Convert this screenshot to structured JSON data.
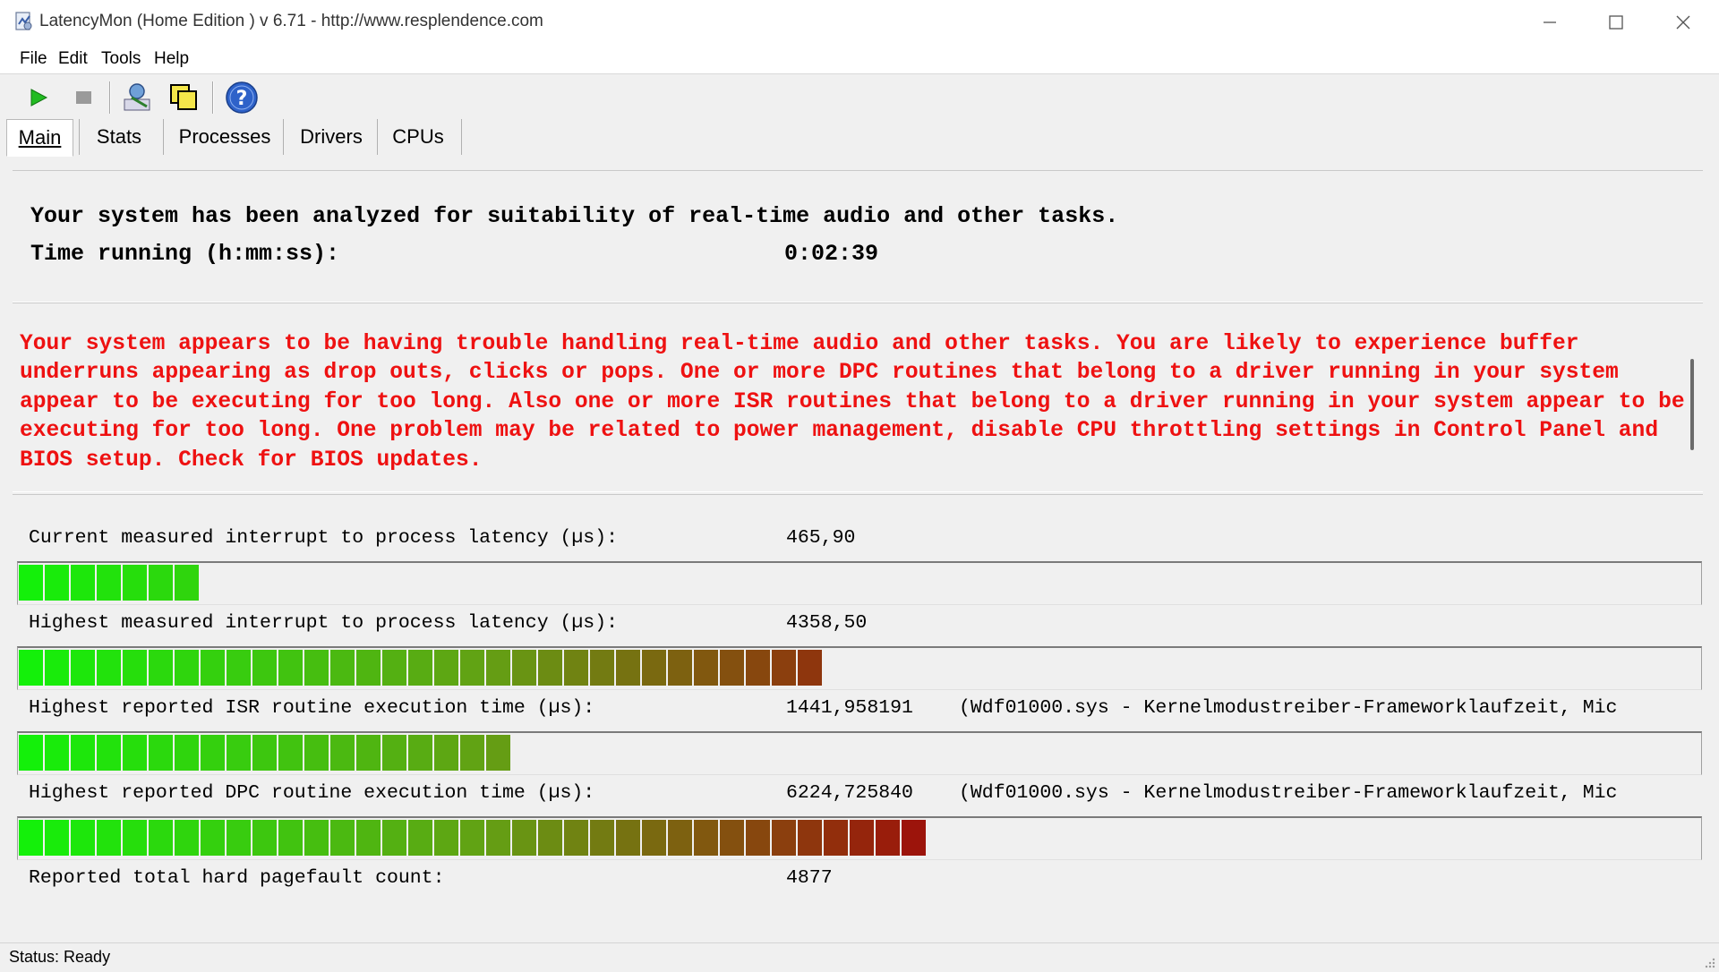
{
  "window": {
    "title": "LatencyMon  (Home Edition )  v 6.71 - http://www.resplendence.com"
  },
  "menu": [
    {
      "label": "File"
    },
    {
      "label": "Edit"
    },
    {
      "label": "Tools"
    },
    {
      "label": "Help"
    }
  ],
  "toolbar": {
    "icons": [
      "play-icon",
      "stop-icon",
      "analyze-icon",
      "windows-icon",
      "help-icon"
    ]
  },
  "tabs": [
    {
      "label": "Main",
      "active": true
    },
    {
      "label": "Stats",
      "active": false
    },
    {
      "label": "Processes",
      "active": false
    },
    {
      "label": "Drivers",
      "active": false
    },
    {
      "label": "CPUs",
      "active": false
    }
  ],
  "summary": {
    "line1": "Your system has been analyzed for suitability of real-time audio and other tasks.",
    "time_label": "Time running (h:mm:ss):",
    "time_value": "0:02:39"
  },
  "warning": {
    "text": "Your system appears to be having trouble handling real-time audio and other tasks. You are likely to experience buffer underruns appearing as drop outs, clicks or pops. One or more DPC routines that belong to a driver running in your system appear to be executing for too long. Also one or more ISR routines that belong to a driver running in your system appear to be executing for too long. One problem may be related to power management, disable CPU throttling settings in Control Panel and BIOS setup. Check for BIOS updates.",
    "color": "#ee1111"
  },
  "metrics": [
    {
      "label": "Current measured interrupt to process latency (µs):",
      "value": "465,90",
      "extra": "",
      "level": 0.103
    },
    {
      "label": "Highest measured interrupt to process latency (µs):",
      "value": "4358,50",
      "extra": "",
      "level": 0.487
    },
    {
      "label": "Highest reported ISR routine execution time (µs):",
      "value": "1441,958191",
      "extra": "(Wdf01000.sys - Kernelmodustreiber-Frameworklaufzeit, Mic",
      "level": 0.293
    },
    {
      "label": "Highest reported DPC routine execution time (µs):",
      "value": "6224,725840",
      "extra": "(Wdf01000.sys - Kernelmodustreiber-Frameworklaufzeit, Mic",
      "level": 0.542
    },
    {
      "label": "Reported total hard pagefault count:",
      "value": "4877",
      "extra": ""
    }
  ],
  "status": {
    "text": "Status: Ready"
  }
}
